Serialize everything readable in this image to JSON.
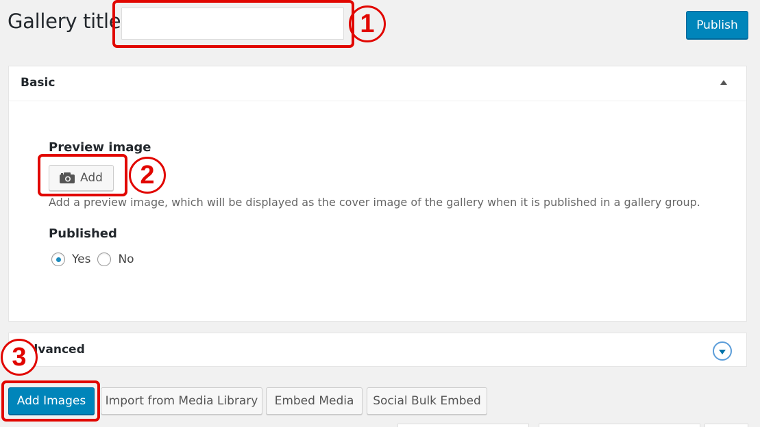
{
  "header": {
    "title_label": "Gallery title",
    "title_value": "",
    "publish_label": "Publish"
  },
  "basic": {
    "heading": "Basic",
    "preview_label": "Preview image",
    "add_label": "Add",
    "help_text": "Add a preview image, which will be displayed as the cover image of the gallery when it is published in a gallery group.",
    "published_label": "Published",
    "options": [
      "Yes",
      "No"
    ],
    "selected": "Yes"
  },
  "advanced": {
    "heading": "Advanced"
  },
  "actions": {
    "add_images": "Add Images",
    "import_media": "Import from Media Library",
    "embed_media": "Embed Media",
    "social_bulk": "Social Bulk Embed"
  },
  "callouts": [
    "1",
    "2",
    "3"
  ],
  "colors": {
    "primary": "#0085ba",
    "callout": "#e10600",
    "radio_dot": "#1e8cbe"
  },
  "icons": {
    "add_button": "camera-icon",
    "basic_toggle": "caret-up-icon",
    "advanced_toggle": "circle-caret-down-icon"
  }
}
